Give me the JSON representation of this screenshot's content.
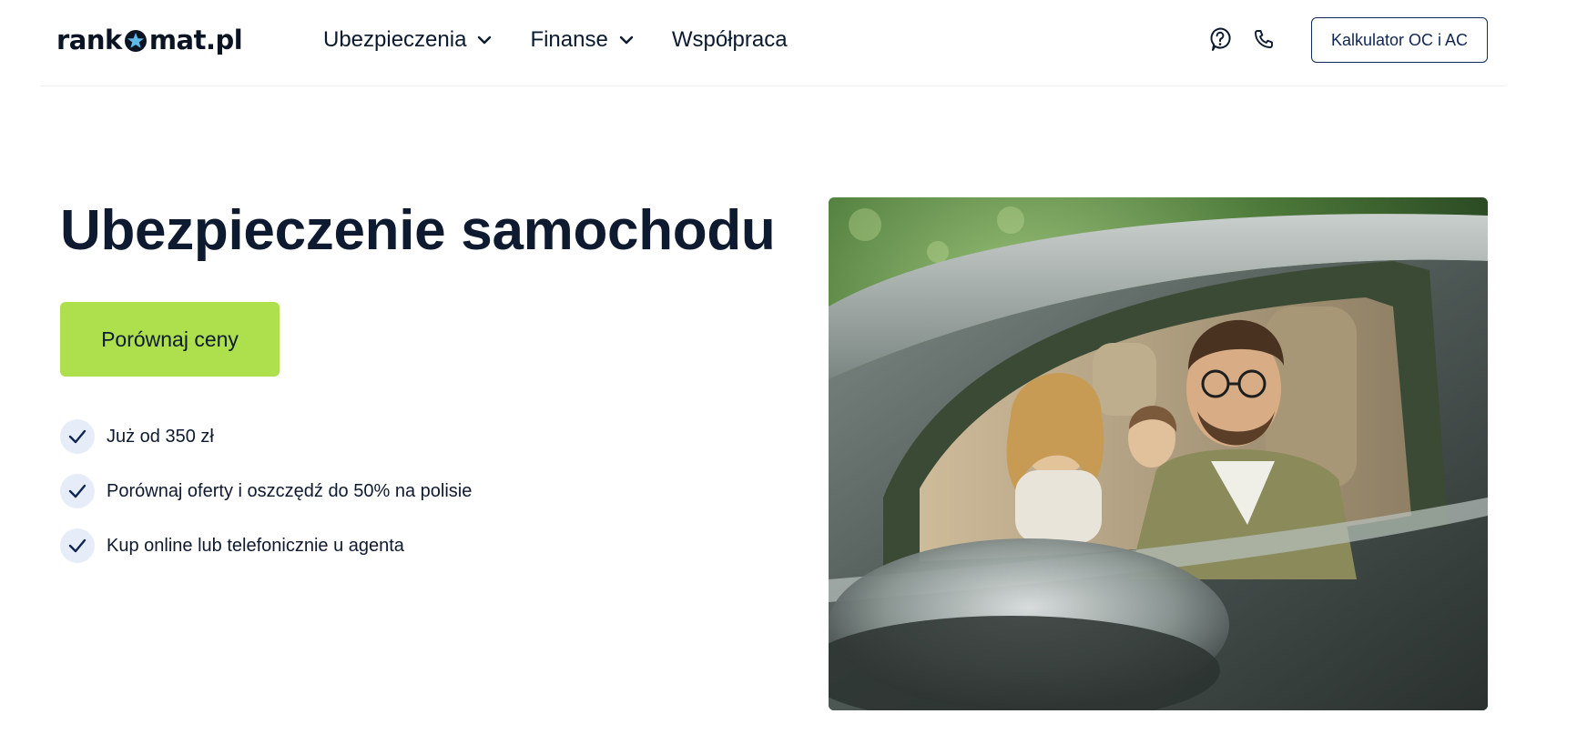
{
  "brand": {
    "logo_prefix": "rank",
    "logo_suffix": "mat.pl",
    "logo_icon": "star-icon",
    "accent_color": "#aedf4d",
    "navy_color": "#0e1a2f"
  },
  "nav": {
    "items": [
      {
        "label": "Ubezpieczenia",
        "has_dropdown": true
      },
      {
        "label": "Finanse",
        "has_dropdown": true
      },
      {
        "label": "Współpraca",
        "has_dropdown": false
      }
    ]
  },
  "header_actions": {
    "help_icon": "help-circle-icon",
    "phone_icon": "phone-icon",
    "calculator_button": "Kalkulator OC i AC"
  },
  "hero": {
    "title": "Ubezpieczenie samochodu",
    "cta_label": "Porównaj ceny",
    "benefits": [
      {
        "text": "Już od 350 zł",
        "icon": "check-icon"
      },
      {
        "text": "Porównaj oferty i oszczędź do 50% na polisie",
        "icon": "check-icon"
      },
      {
        "text": "Kup online lub telefonicznie u agenta",
        "icon": "check-icon"
      }
    ],
    "image_icon": "family-in-car-photo"
  }
}
